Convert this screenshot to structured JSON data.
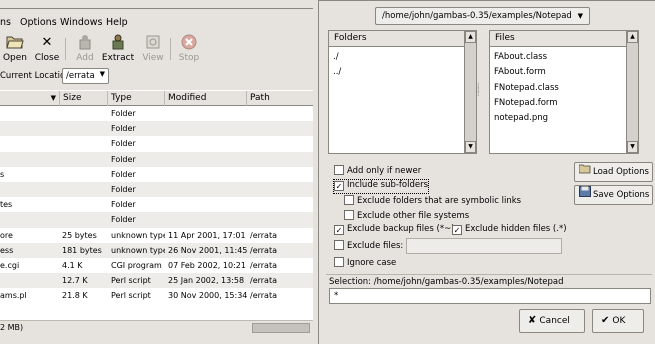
{
  "left_window": {
    "menus": [
      "ns",
      "Options",
      "Windows",
      "Help"
    ],
    "toolbar": {
      "open": "Open",
      "close": "Close",
      "add": "Add",
      "extract": "Extract",
      "view": "View",
      "stop": "Stop"
    },
    "location_label": "Current Location:",
    "location_value": "/errata",
    "columns": [
      "Size",
      "Type",
      "Modified",
      "Path"
    ],
    "rows": [
      {
        "name": "",
        "size": "",
        "type": "Folder",
        "modified": "",
        "path": ""
      },
      {
        "name": "",
        "size": "",
        "type": "Folder",
        "modified": "",
        "path": ""
      },
      {
        "name": "",
        "size": "",
        "type": "Folder",
        "modified": "",
        "path": ""
      },
      {
        "name": "",
        "size": "",
        "type": "Folder",
        "modified": "",
        "path": ""
      },
      {
        "name": "s",
        "size": "",
        "type": "Folder",
        "modified": "",
        "path": ""
      },
      {
        "name": "",
        "size": "",
        "type": "Folder",
        "modified": "",
        "path": ""
      },
      {
        "name": "tes",
        "size": "",
        "type": "Folder",
        "modified": "",
        "path": ""
      },
      {
        "name": "",
        "size": "",
        "type": "Folder",
        "modified": "",
        "path": ""
      },
      {
        "name": "ore",
        "size": "25 bytes",
        "type": "unknown type",
        "modified": "11 Apr 2001, 17:01",
        "path": "/errata"
      },
      {
        "name": "ess",
        "size": "181 bytes",
        "type": "unknown type",
        "modified": "26 Nov 2001, 11:45",
        "path": "/errata"
      },
      {
        "name": "e.cgi",
        "size": "4.1 K",
        "type": "CGI program",
        "modified": "07 Feb 2002, 10:21",
        "path": "/errata"
      },
      {
        "name": "",
        "size": "12.7 K",
        "type": "Perl script",
        "modified": "25 Jan 2002, 13:58",
        "path": "/errata"
      },
      {
        "name": "ams.pl",
        "size": "21.8 K",
        "type": "Perl script",
        "modified": "30 Nov 2000, 15:34",
        "path": "/errata"
      }
    ],
    "status_text": "2 MB)"
  },
  "dialog": {
    "path": "/home/john/gambas-0.35/examples/Notepad",
    "folders_header": "Folders",
    "folders": [
      "./",
      "../"
    ],
    "files_header": "Files",
    "files": [
      "FAbout.class",
      "FAbout.form",
      "FNotepad.class",
      "FNotepad.form",
      "notepad.png"
    ],
    "options": {
      "add_only_newer": {
        "label": "Add only if newer",
        "checked": false
      },
      "include_subfolders": {
        "label": "Include sub-folders",
        "checked": true
      },
      "exclude_symlinks": {
        "label": "Exclude folders that are symbolic links",
        "checked": false
      },
      "exclude_other_fs": {
        "label": "Exclude other file systems",
        "checked": false
      },
      "exclude_backup": {
        "label": "Exclude backup files (*~)",
        "checked": true
      },
      "exclude_hidden": {
        "label": "Exclude hidden files (.*)",
        "checked": true
      },
      "exclude_files": {
        "label": "Exclude files:",
        "checked": false,
        "value": ""
      },
      "ignore_case": {
        "label": "Ignore case",
        "checked": false
      }
    },
    "load_options": "Load Options",
    "save_options": "Save Options",
    "selection_label": "Selection: /home/john/gambas-0.35/examples/Notepad",
    "selection_value": "*",
    "cancel": "Cancel",
    "ok": "OK"
  }
}
